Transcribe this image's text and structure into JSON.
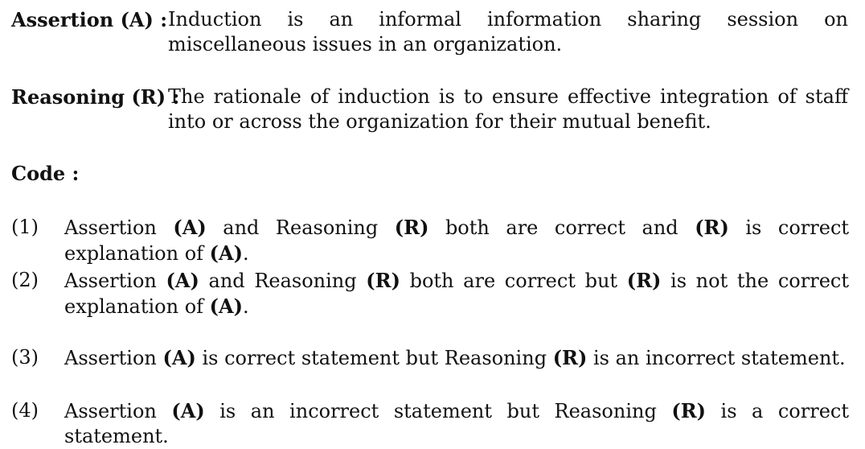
{
  "assertion": {
    "label": "Assertion (A) :",
    "text": "Induction is an informal information sharing session on miscellaneous issues in an organization."
  },
  "reasoning": {
    "label": "Reasoning (R) :",
    "text": "The rationale of induction is to ensure effective integration of staff into or across the organization for their mutual benefit."
  },
  "code": {
    "heading": "Code :"
  },
  "options": [
    {
      "number": "(1)",
      "parts": [
        "Assertion ",
        "(A)",
        " and Reasoning ",
        "(R)",
        " both are correct and ",
        "(R)",
        " is correct explanation of ",
        "(A)",
        "."
      ]
    },
    {
      "number": "(2)",
      "parts": [
        "Assertion ",
        "(A)",
        " and Reasoning ",
        "(R)",
        " both are correct but ",
        "(R)",
        " is not the correct explanation of ",
        "(A)",
        "."
      ]
    },
    {
      "number": "(3)",
      "parts": [
        "Assertion ",
        "(A)",
        " is correct statement but Reasoning ",
        "(R)",
        " is an incorrect statement."
      ]
    },
    {
      "number": "(4)",
      "parts": [
        "Assertion ",
        "(A)",
        " is an incorrect statement but Reasoning ",
        "(R)",
        " is a correct statement."
      ]
    }
  ]
}
